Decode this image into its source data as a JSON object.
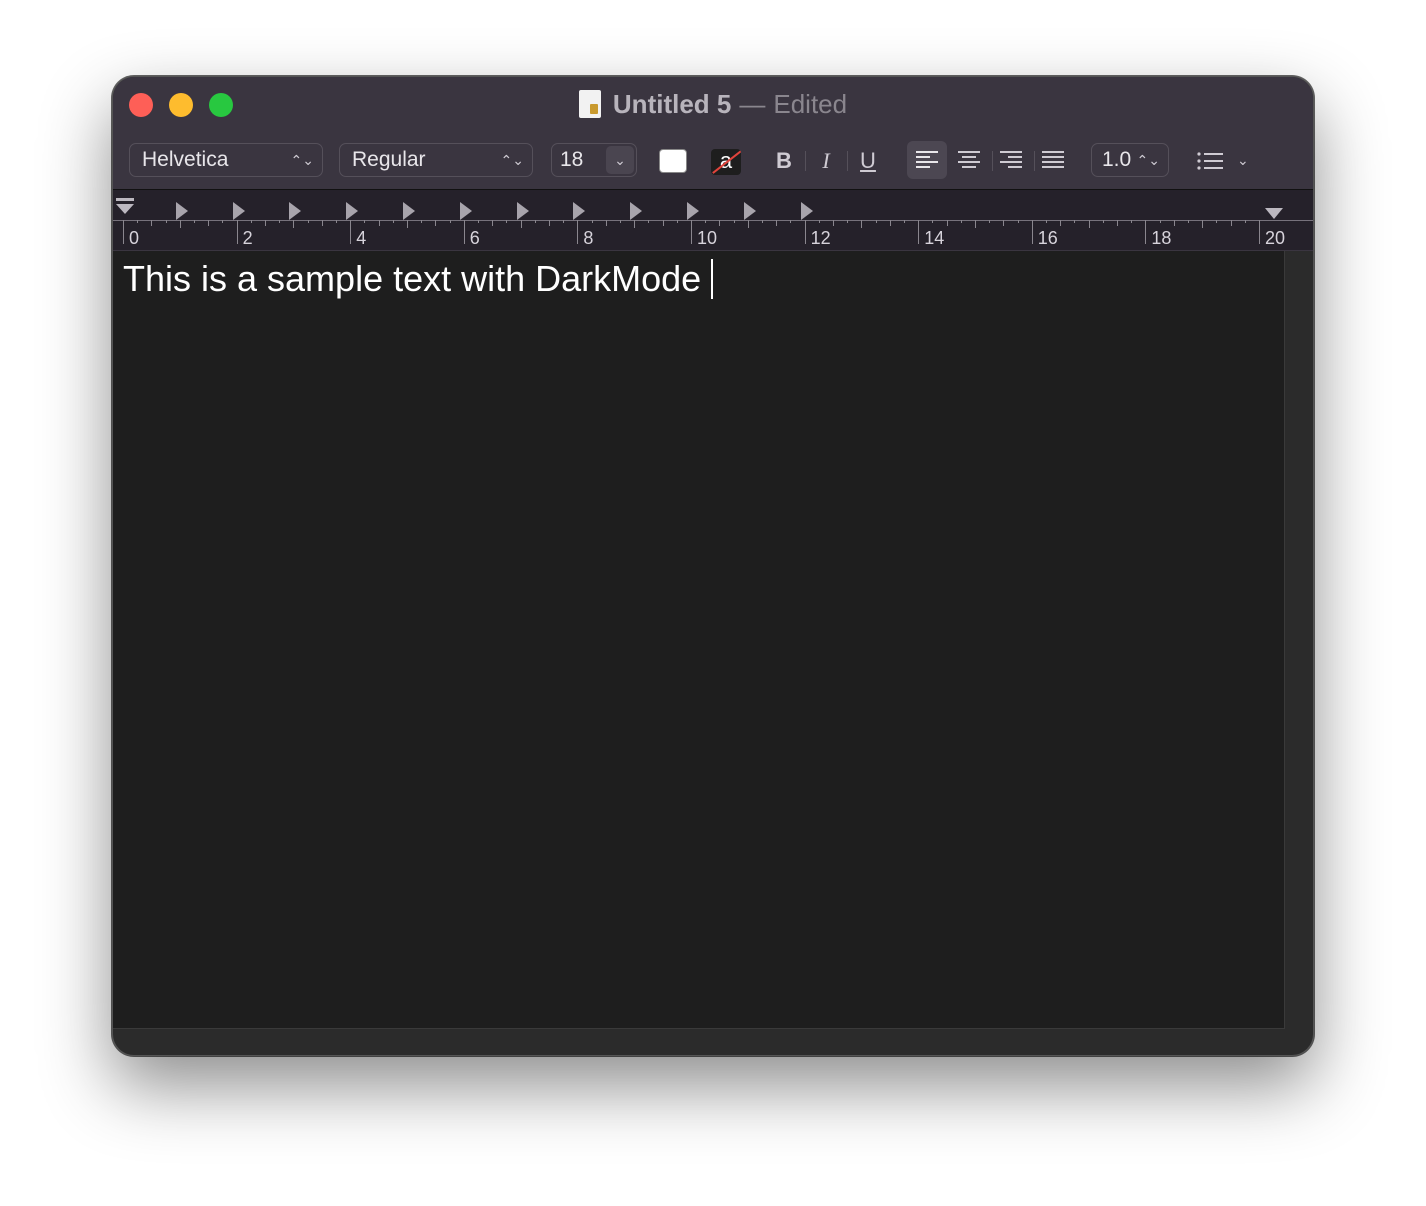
{
  "window": {
    "title": "Untitled 5",
    "separator": "—",
    "status": "Edited"
  },
  "toolbar": {
    "font_family": "Helvetica",
    "font_style": "Regular",
    "font_size": "18",
    "bold_label": "B",
    "italic_label": "I",
    "underline_label": "U",
    "highlight_label": "a",
    "line_spacing": "1.0",
    "text_color": "#ffffff",
    "alignment_selected": "left"
  },
  "ruler": {
    "labels": [
      "0",
      "2",
      "4",
      "6",
      "8",
      "10",
      "12",
      "14",
      "16",
      "18",
      "20"
    ]
  },
  "editor": {
    "text": "This is a sample text with DarkMode"
  },
  "colors": {
    "close": "#fe5f57",
    "minimize": "#febc2e",
    "maximize": "#28c840",
    "titlebar": "#3a3540",
    "editor_bg": "#1e1e1e"
  }
}
